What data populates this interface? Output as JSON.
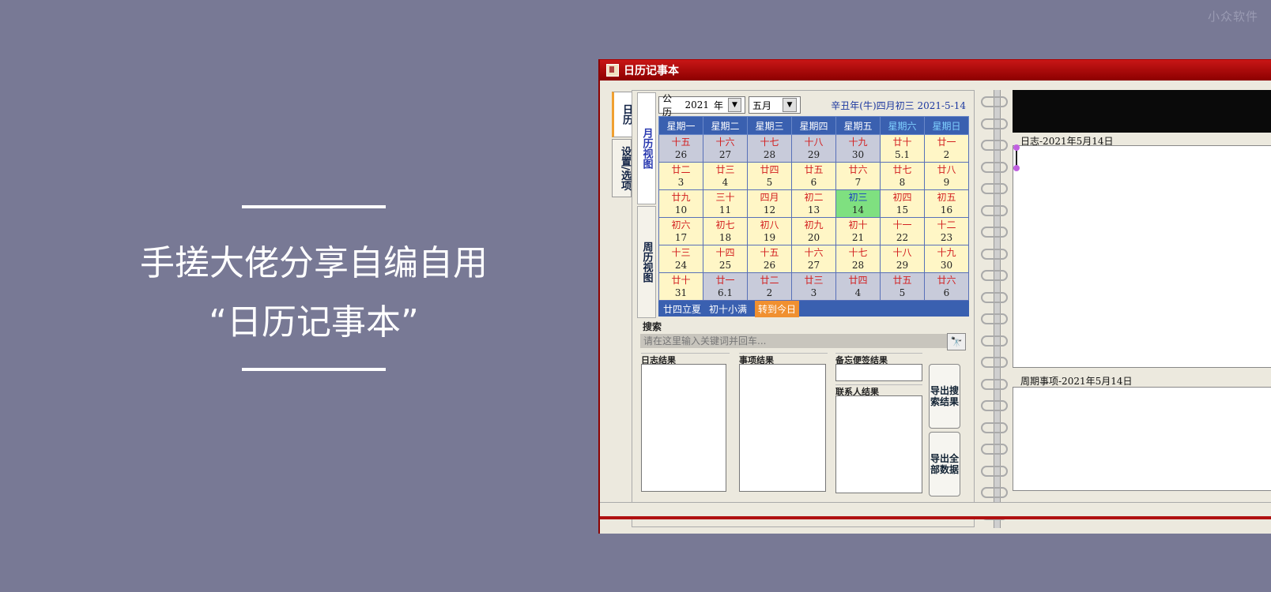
{
  "watermark": "小众软件",
  "headline": {
    "line1": "手搓大佬分享自编自用",
    "line2": "“日历记事本”"
  },
  "window": {
    "title": "日历记事本"
  },
  "side_tabs": [
    "日历",
    "设置/选项"
  ],
  "view_tabs": [
    "月历视图",
    "周历视图"
  ],
  "calendar": {
    "calendar_type": "公历",
    "year": "2021",
    "year_suffix": "年",
    "month": "五月",
    "lunar_info": "辛丑年(牛)四月初三  2021-5-14",
    "weekdays": [
      "星期一",
      "星期二",
      "星期三",
      "星期四",
      "星期五",
      "星期六",
      "星期日"
    ],
    "weeks": [
      [
        {
          "l": "十五",
          "s": "26",
          "o": true
        },
        {
          "l": "十六",
          "s": "27",
          "o": true
        },
        {
          "l": "十七",
          "s": "28",
          "o": true
        },
        {
          "l": "十八",
          "s": "29",
          "o": true
        },
        {
          "l": "十九",
          "s": "30",
          "o": true
        },
        {
          "l": "廿十",
          "s": "5.1",
          "o": false
        },
        {
          "l": "廿一",
          "s": "2",
          "o": false
        }
      ],
      [
        {
          "l": "廿二",
          "s": "3",
          "o": false
        },
        {
          "l": "廿三",
          "s": "4",
          "o": false
        },
        {
          "l": "廿四",
          "s": "5",
          "o": false
        },
        {
          "l": "廿五",
          "s": "6",
          "o": false
        },
        {
          "l": "廿六",
          "s": "7",
          "o": false
        },
        {
          "l": "廿七",
          "s": "8",
          "o": false
        },
        {
          "l": "廿八",
          "s": "9",
          "o": false
        }
      ],
      [
        {
          "l": "廿九",
          "s": "10",
          "o": false
        },
        {
          "l": "三十",
          "s": "11",
          "o": false
        },
        {
          "l": "四月",
          "s": "12",
          "o": false
        },
        {
          "l": "初二",
          "s": "13",
          "o": false
        },
        {
          "l": "初三",
          "s": "14",
          "o": false,
          "today": true
        },
        {
          "l": "初四",
          "s": "15",
          "o": false
        },
        {
          "l": "初五",
          "s": "16",
          "o": false
        }
      ],
      [
        {
          "l": "初六",
          "s": "17",
          "o": false
        },
        {
          "l": "初七",
          "s": "18",
          "o": false
        },
        {
          "l": "初八",
          "s": "19",
          "o": false
        },
        {
          "l": "初九",
          "s": "20",
          "o": false
        },
        {
          "l": "初十",
          "s": "21",
          "o": false
        },
        {
          "l": "十一",
          "s": "22",
          "o": false
        },
        {
          "l": "十二",
          "s": "23",
          "o": false
        }
      ],
      [
        {
          "l": "十三",
          "s": "24",
          "o": false
        },
        {
          "l": "十四",
          "s": "25",
          "o": false
        },
        {
          "l": "十五",
          "s": "26",
          "o": false
        },
        {
          "l": "十六",
          "s": "27",
          "o": false
        },
        {
          "l": "十七",
          "s": "28",
          "o": false
        },
        {
          "l": "十八",
          "s": "29",
          "o": false
        },
        {
          "l": "十九",
          "s": "30",
          "o": false
        }
      ],
      [
        {
          "l": "廿十",
          "s": "31",
          "o": false
        },
        {
          "l": "廿一",
          "s": "6.1",
          "o": true
        },
        {
          "l": "廿二",
          "s": "2",
          "o": true
        },
        {
          "l": "廿三",
          "s": "3",
          "o": true
        },
        {
          "l": "廿四",
          "s": "4",
          "o": true
        },
        {
          "l": "廿五",
          "s": "5",
          "o": true
        },
        {
          "l": "廿六",
          "s": "6",
          "o": true
        }
      ]
    ],
    "solar_terms": [
      "廿四立夏",
      "初十小满"
    ],
    "goto_today": "转到今日"
  },
  "search": {
    "label": "搜索",
    "placeholder": "请在这里输入关键词并回车...",
    "results": {
      "diary": "日志结果",
      "items": "事项结果",
      "memo": "备忘便签结果",
      "contacts": "联系人结果"
    },
    "export_results": "导出搜索结果",
    "export_all": "导出全部数据"
  },
  "diary_label": "日志-2021年5月14日",
  "cycle_label": "周期事项-2021年5月14日",
  "colors": {
    "titlebar": "#b00000",
    "header_blue": "#3a60b0",
    "cell_yellow": "#fff6c6",
    "today_green": "#7fe080",
    "lunar_red": "#d21f1f"
  }
}
